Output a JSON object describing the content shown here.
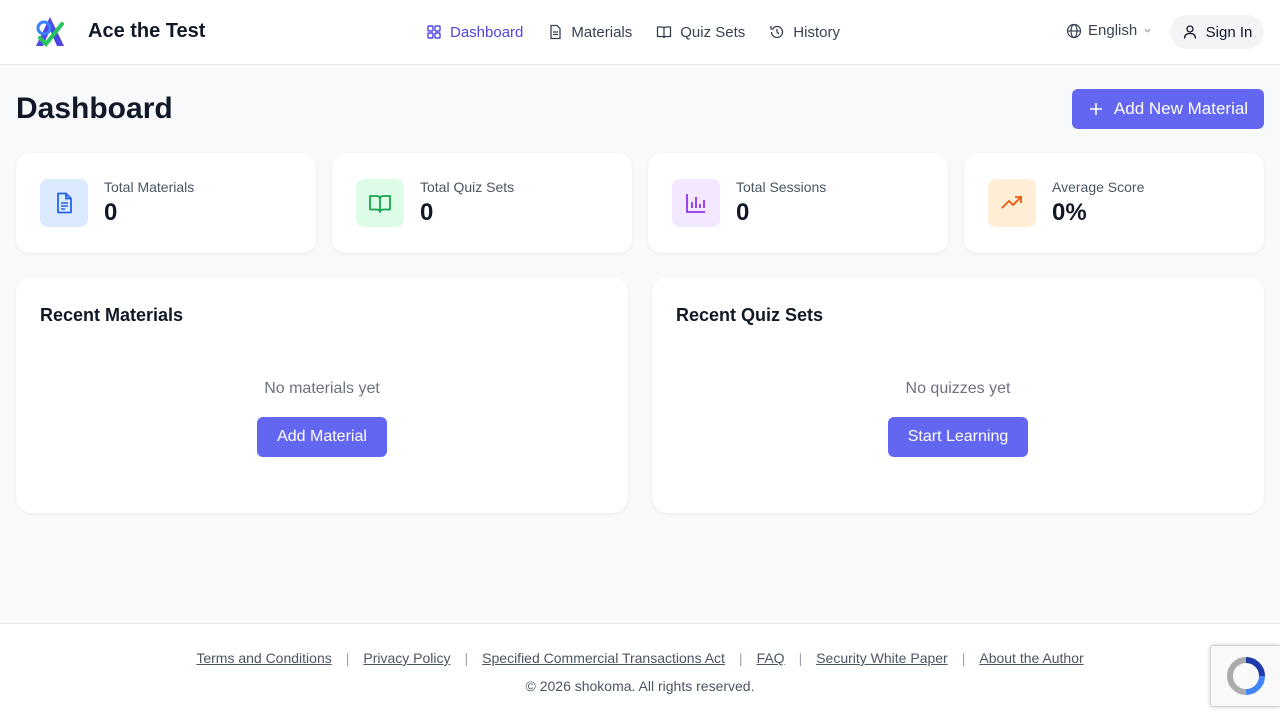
{
  "header": {
    "brand": "Ace the Test",
    "nav": [
      {
        "label": "Dashboard",
        "icon": "grid-icon",
        "active": true
      },
      {
        "label": "Materials",
        "icon": "file-icon",
        "active": false
      },
      {
        "label": "Quiz Sets",
        "icon": "book-icon",
        "active": false
      },
      {
        "label": "History",
        "icon": "history-icon",
        "active": false
      }
    ],
    "language": "English",
    "sign_in": "Sign In"
  },
  "page": {
    "title": "Dashboard",
    "add_new_label": "Add New Material"
  },
  "stats": [
    {
      "label": "Total Materials",
      "value": "0",
      "icon": "file-text-icon",
      "color": "#2563eb",
      "bg": "#dbeafe"
    },
    {
      "label": "Total Quiz Sets",
      "value": "0",
      "icon": "book-open-icon",
      "color": "#16a34a",
      "bg": "#dcfce7"
    },
    {
      "label": "Total Sessions",
      "value": "0",
      "icon": "bar-chart-icon",
      "color": "#9333ea",
      "bg": "#f3e8ff"
    },
    {
      "label": "Average Score",
      "value": "0%",
      "icon": "trending-up-icon",
      "color": "#ea580c",
      "bg": "#ffedd5"
    }
  ],
  "panels": {
    "recent_materials": {
      "title": "Recent Materials",
      "empty": "No materials yet",
      "button": "Add Material"
    },
    "recent_quiz_sets": {
      "title": "Recent Quiz Sets",
      "empty": "No quizzes yet",
      "button": "Start Learning"
    }
  },
  "footer": {
    "links": [
      "Terms and Conditions",
      "Privacy Policy",
      "Specified Commercial Transactions Act",
      "FAQ",
      "Security White Paper",
      "About the Author"
    ],
    "copyright": "© 2026 shokoma. All rights reserved."
  },
  "colors": {
    "accent": "#6366f1",
    "accent_text": "#4f46e5"
  }
}
